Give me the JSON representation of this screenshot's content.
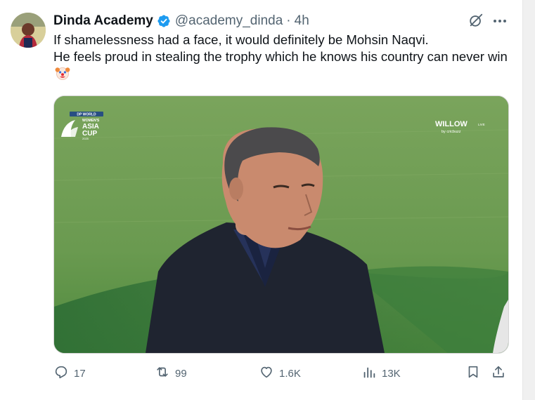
{
  "tweet": {
    "author_name": "Dinda Academy",
    "handle": "@academy_dinda",
    "separator": "·",
    "time": "4h",
    "text_line1": "If shamelessness had a face, it would definitely be Mohsin Naqvi.",
    "text_line2": "He feels proud in stealing the trophy which he knows his country can never win"
  },
  "media": {
    "logo_line1": "DP WORLD",
    "logo_line2": "WOMEN'S",
    "logo_line3": "ASIA",
    "logo_line4": "CUP",
    "logo_line5": "2025",
    "broadcaster_main": "WILLOW",
    "broadcaster_live": "LIVE",
    "broadcaster_sub": "by cricbuzz"
  },
  "actions": {
    "replies": "17",
    "reposts": "99",
    "likes": "1.6K",
    "views": "13K"
  },
  "colors": {
    "text": "#0f1419",
    "muted": "#536471",
    "verified": "#1d9bf0",
    "grass": "#6a9a52"
  },
  "icons": [
    "avatar",
    "verified-badge-icon",
    "grok-icon",
    "more-icon",
    "clown-emoji-icon",
    "reply-icon",
    "repost-icon",
    "like-icon",
    "views-icon",
    "bookmark-icon",
    "share-icon"
  ]
}
